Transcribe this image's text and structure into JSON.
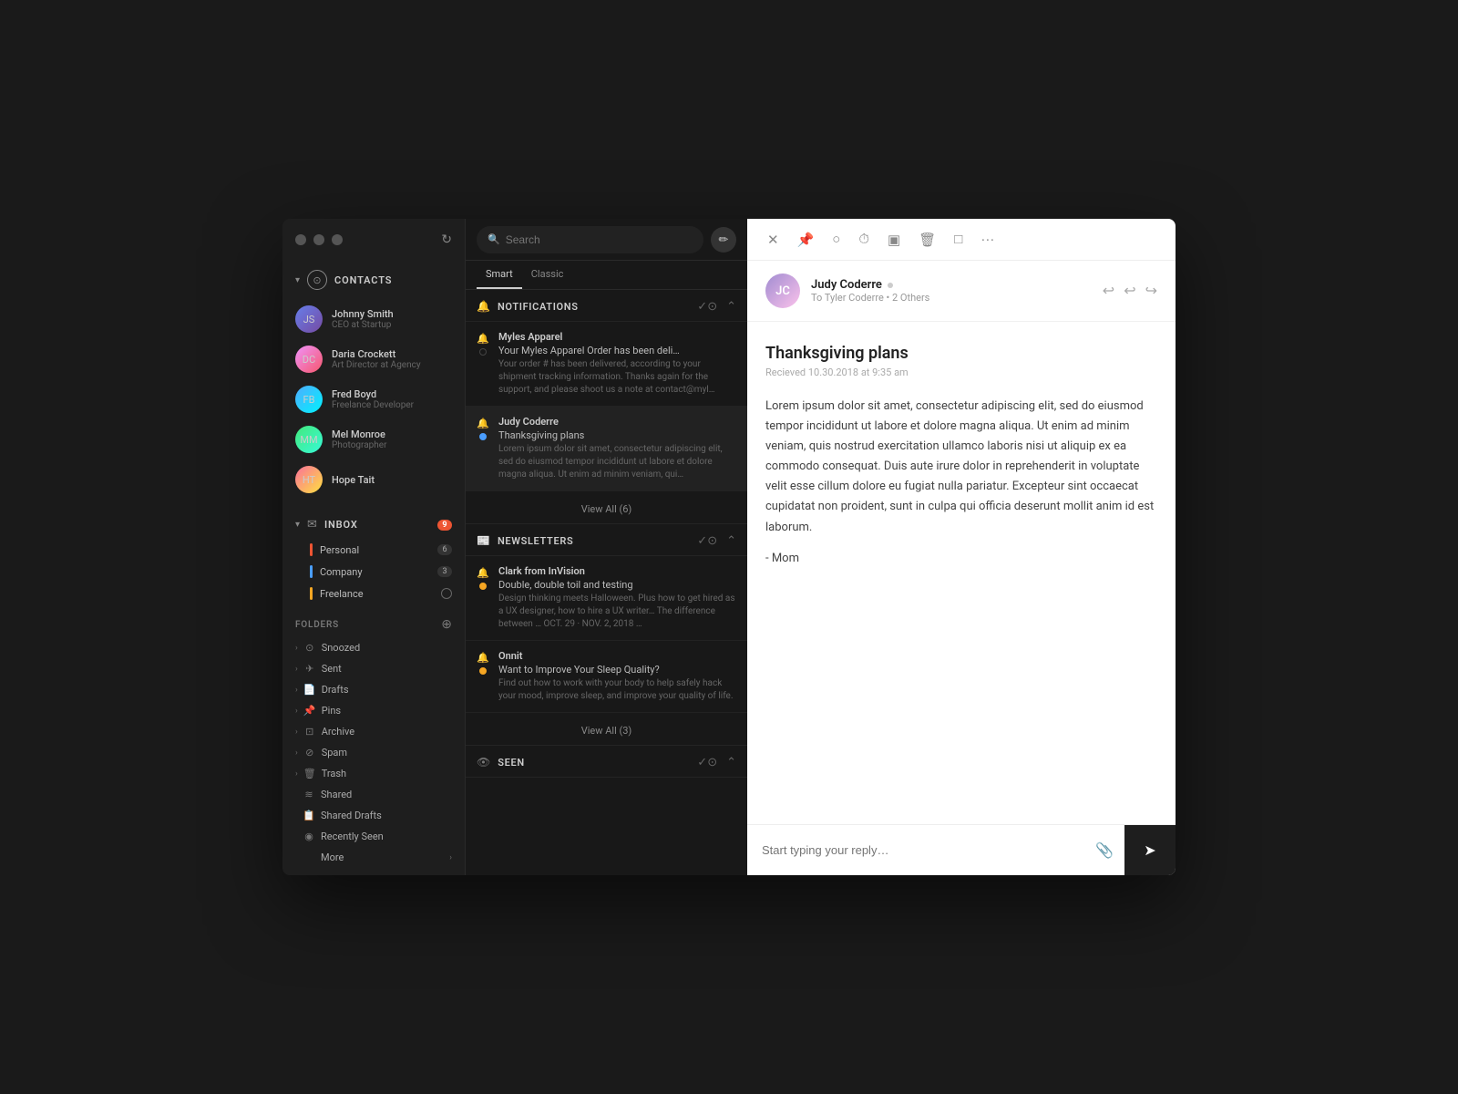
{
  "window": {
    "controls": {
      "close": "×",
      "min": "−",
      "max": "+"
    },
    "refresh_icon": "↻"
  },
  "sidebar": {
    "contacts_label": "CONTACTS",
    "contacts": [
      {
        "name": "Johnny Smith",
        "title": "CEO at Startup",
        "initials": "JS",
        "avatar_class": "avatar-js"
      },
      {
        "name": "Daria Crockett",
        "title": "Art Director at Agency",
        "initials": "DC",
        "avatar_class": "avatar-dc"
      },
      {
        "name": "Fred Boyd",
        "title": "Freelance Developer",
        "initials": "FB",
        "avatar_class": "avatar-fb"
      },
      {
        "name": "Mel Monroe",
        "title": "Photographer",
        "initials": "MM",
        "avatar_class": "avatar-mm"
      },
      {
        "name": "Hope Tait",
        "title": "",
        "initials": "HT",
        "avatar_class": "avatar-ht"
      }
    ],
    "inbox_label": "INBOX",
    "inbox_badge": "9",
    "inbox_items": [
      {
        "label": "Personal",
        "color": "#e53",
        "badge": "6",
        "type": "badge"
      },
      {
        "label": "Company",
        "color": "#4a9eff",
        "badge": "3",
        "type": "badge"
      },
      {
        "label": "Freelance",
        "color": "#f5a623",
        "badge": "",
        "type": "circle"
      }
    ],
    "folders_label": "Folders",
    "folders": [
      {
        "label": "Snoozed",
        "icon": "⊙",
        "has_chevron": true
      },
      {
        "label": "Sent",
        "icon": "✈",
        "has_chevron": true
      },
      {
        "label": "Drafts",
        "icon": "📄",
        "has_chevron": true
      },
      {
        "label": "Pins",
        "icon": "📌",
        "has_chevron": true
      },
      {
        "label": "Archive",
        "icon": "⊡",
        "has_chevron": true
      },
      {
        "label": "Spam",
        "icon": "⊘",
        "has_chevron": true
      },
      {
        "label": "Trash",
        "icon": "🗑",
        "has_chevron": true
      }
    ],
    "plain_folders": [
      {
        "label": "Shared",
        "icon": "≋"
      },
      {
        "label": "Shared Drafts",
        "icon": "📋"
      },
      {
        "label": "Recently Seen",
        "icon": "◉"
      },
      {
        "label": "More",
        "icon": "",
        "has_right_chevron": true
      }
    ]
  },
  "middle": {
    "search_placeholder": "Search",
    "tabs": [
      {
        "label": "Smart",
        "active": true
      },
      {
        "label": "Classic",
        "active": false
      }
    ],
    "sections": [
      {
        "title": "NOTIFICATIONS",
        "icon": "🔔",
        "emails": [
          {
            "sender": "Myles Apparel",
            "subject": "Your Myles Apparel Order has been deli…",
            "preview": "Your order # has been delivered, according to your shipment tracking information. Thanks again for the support, and please shoot us a note at contact@myl…",
            "dot_type": "none"
          },
          {
            "sender": "Judy Coderre",
            "subject": "Thanksgiving plans",
            "preview": "Lorem ipsum dolor sit amet, consectetur adipiscing elit, sed do eiusmod tempor incididunt ut labore et dolore magna aliqua. Ut enim ad minim veniam, qui…",
            "dot_type": "unread-blue",
            "active": true
          }
        ],
        "view_all": "View All (6)"
      },
      {
        "title": "NEWSLETTERS",
        "icon": "📰",
        "emails": [
          {
            "sender": "Clark from InVision",
            "subject": "Double, double toil and testing",
            "preview": "Design thinking meets Halloween. Plus how to get hired as a UX designer, how to hire a UX writer… The difference between … OCT. 29 · NOV. 2, 2018 …",
            "dot_type": "unread-orange"
          },
          {
            "sender": "Onnit",
            "subject": "Want to Improve Your Sleep Quality?",
            "preview": "Find out how to work with your body to help safely hack your mood, improve sleep, and improve your quality of life.",
            "dot_type": "unread-orange"
          }
        ],
        "view_all": "View All (3)"
      },
      {
        "title": "SEEN",
        "icon": "👁",
        "emails": []
      }
    ]
  },
  "email": {
    "from_name": "Judy Coderre",
    "from_dot": "·",
    "to": "To Tyler Coderre • 2 Others",
    "subject": "Thanksgiving plans",
    "date": "Recieved 10.30.2018 at 9:35 am",
    "body": "Lorem ipsum dolor sit amet, consectetur adipiscing elit, sed do eiusmod tempor incididunt ut labore et dolore magna aliqua. Ut enim ad minim veniam, quis nostrud exercitation ullamco laboris nisi ut aliquip ex ea commodo consequat. Duis aute irure dolor in reprehenderit in voluptate velit esse cillum dolore eu fugiat nulla pariatur. Excepteur sint occaecat cupidatat non proident, sunt in culpa qui officia deserunt mollit anim id est laborum.",
    "signature": "- Mom",
    "reply_placeholder": "Start typing your reply…",
    "toolbar_buttons": [
      "×",
      "📌",
      "○",
      "⏱",
      "▣",
      "🗑",
      "□",
      "···"
    ],
    "reply_actions": [
      "↩",
      "↩",
      "↪"
    ]
  }
}
